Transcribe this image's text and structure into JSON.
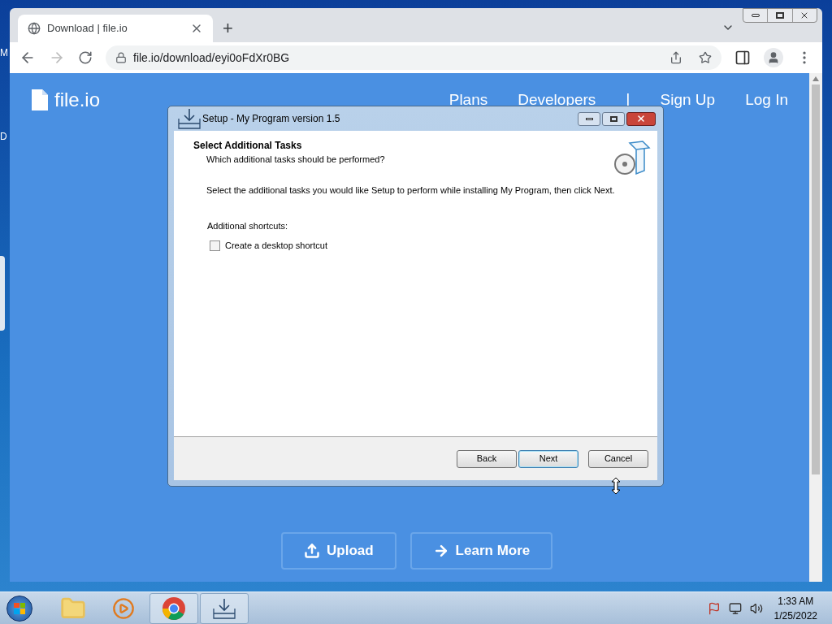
{
  "desktop_labels": [
    "M",
    "D"
  ],
  "browser": {
    "tab": {
      "title": "Download | file.io",
      "selected": true
    },
    "new_tab": "+",
    "url": "file.io/download/eyi0oFdXr0BG"
  },
  "site": {
    "logo": "file.io",
    "nav": [
      {
        "label": "Plans"
      },
      {
        "label": "Developers"
      },
      {
        "label": "|",
        "kind": "divider"
      },
      {
        "label": "Sign Up"
      },
      {
        "label": "Log In"
      }
    ],
    "buttons": [
      {
        "label": "Upload",
        "kind": "upload"
      },
      {
        "label": "Learn More",
        "kind": "arrow"
      }
    ]
  },
  "dialog": {
    "title": "Setup - My Program version 1.5",
    "heading": "Select Additional Tasks",
    "subheading": "Which additional tasks should be performed?",
    "instruction": "Select the additional tasks you would like Setup to perform while installing My Program, then click Next.",
    "group_label": "Additional shortcuts:",
    "options": [
      {
        "label": "Create a desktop shortcut",
        "checked": false
      }
    ],
    "buttons": [
      {
        "label": "Back",
        "default": false
      },
      {
        "label": "Next",
        "default": true
      },
      {
        "label": "Cancel",
        "default": false
      }
    ]
  },
  "taskbar": {
    "apps": [
      {
        "kind": "folder",
        "active": false
      },
      {
        "kind": "media",
        "active": false
      },
      {
        "kind": "browser",
        "active": true
      },
      {
        "kind": "installer",
        "active": true
      }
    ],
    "time": "1:33 AM",
    "date": "1/25/2022"
  }
}
